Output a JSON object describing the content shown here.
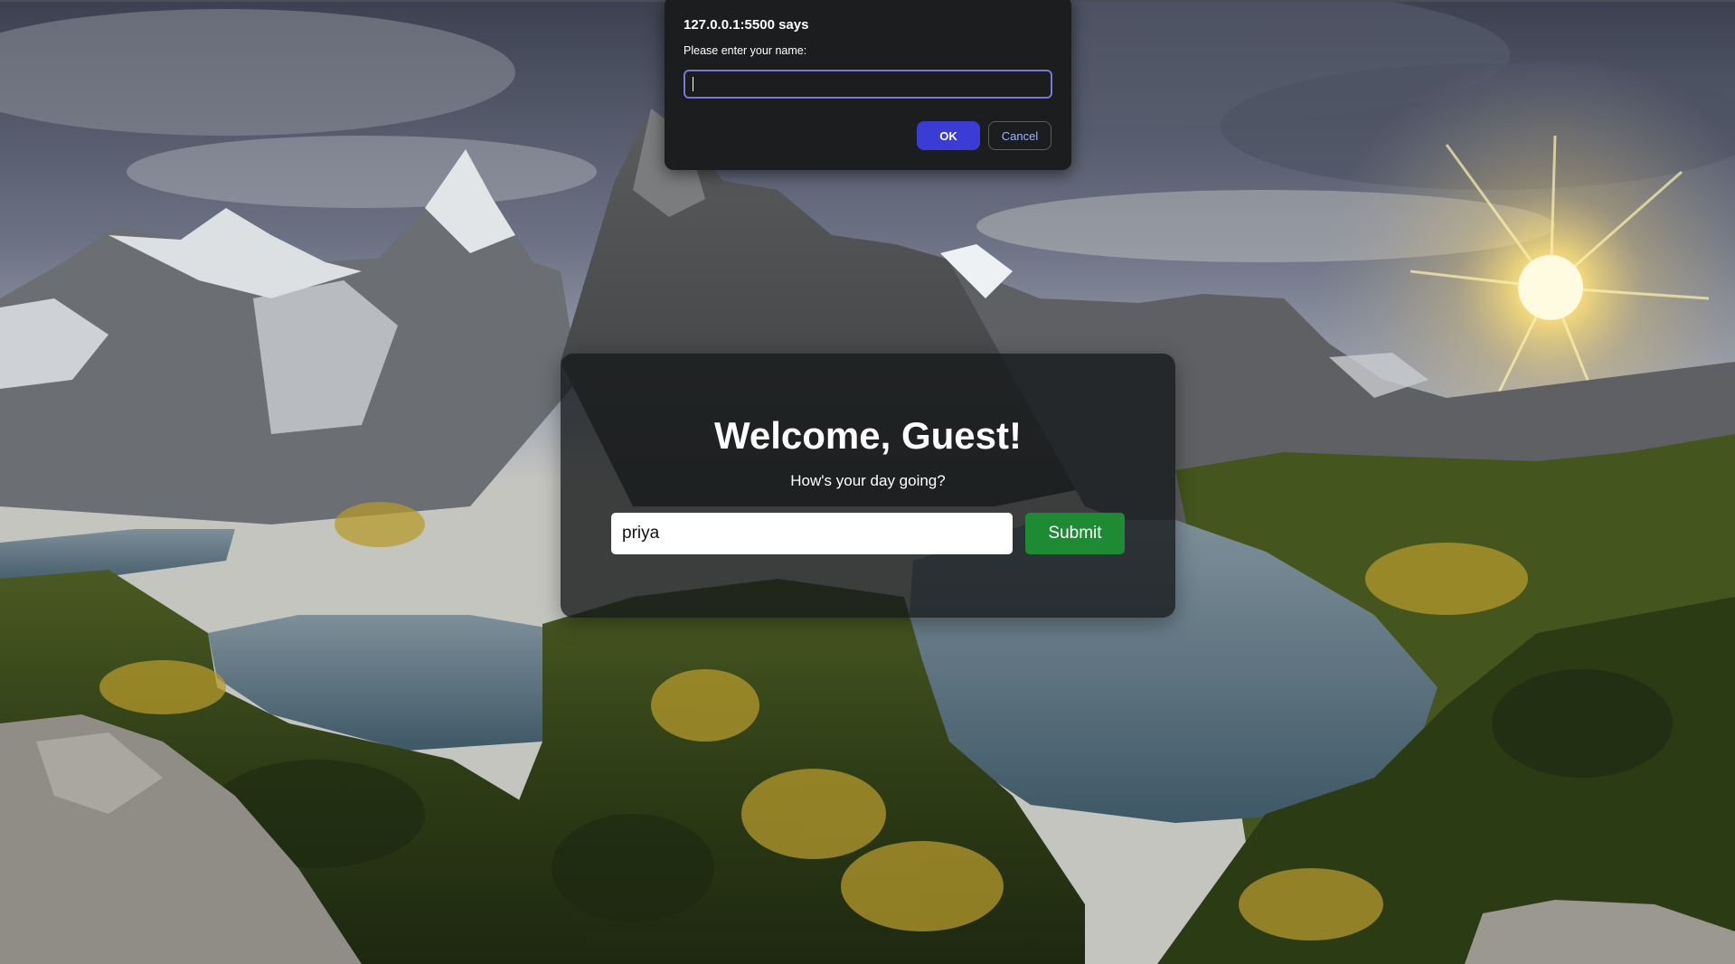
{
  "background": {
    "description_icon": "mountain-landscape-image"
  },
  "card": {
    "title": "Welcome, Guest!",
    "subtitle": "How's your day going?",
    "input_value": "priya",
    "submit_label": "Submit",
    "submit_color": "#1f8a34"
  },
  "dialog": {
    "origin": "127.0.0.1:5500 says",
    "message": "Please enter your name:",
    "input_value": "",
    "ok_label": "OK",
    "cancel_label": "Cancel",
    "ok_color": "#3b3bd6"
  }
}
